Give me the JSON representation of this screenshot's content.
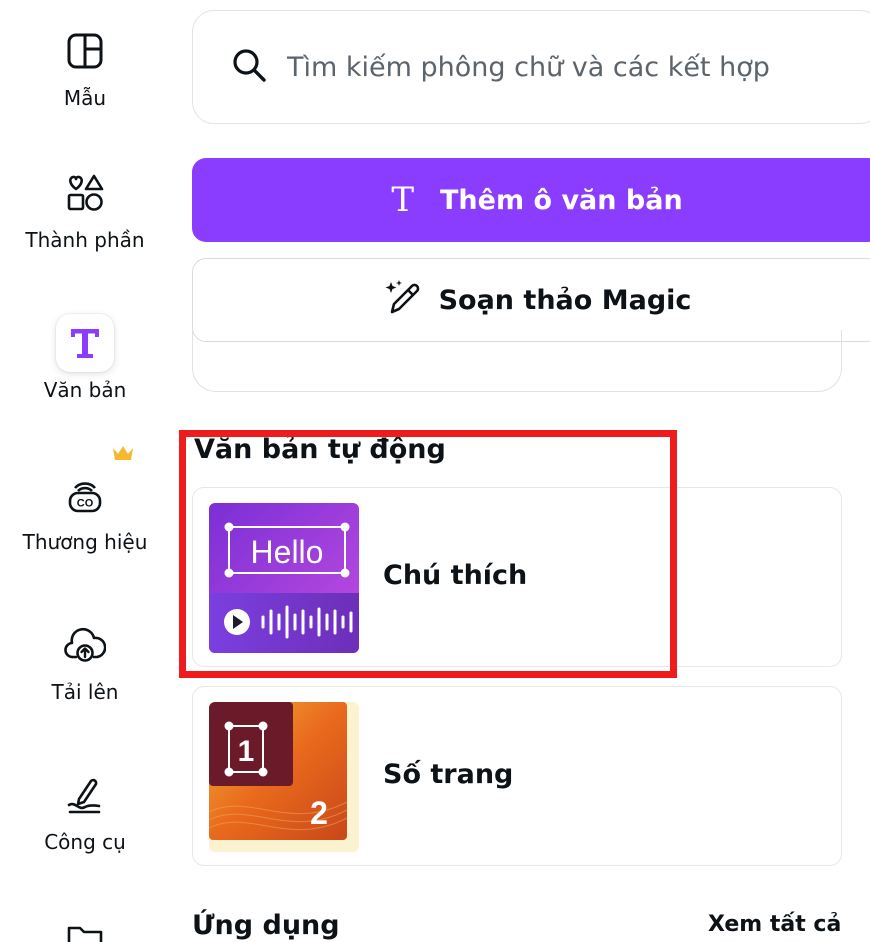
{
  "sidebar": {
    "items": [
      {
        "label": "Mẫu",
        "icon": "template-icon"
      },
      {
        "label": "Thành phần",
        "icon": "elements-icon"
      },
      {
        "label": "Văn bản",
        "icon": "text-icon",
        "active": true
      },
      {
        "label": "Thương hiệu",
        "icon": "brand-icon",
        "badge": "crown-icon"
      },
      {
        "label": "Tải lên",
        "icon": "upload-cloud-icon"
      },
      {
        "label": "Công cụ",
        "icon": "draw-pen-icon"
      },
      {
        "label": "",
        "icon": "folder-icon"
      }
    ]
  },
  "search": {
    "placeholder": "Tìm kiếm phông chữ và các kết hợp",
    "value": ""
  },
  "actions": {
    "add_textbox": "Thêm ô văn bản",
    "magic_write": "Soạn thảo Magic"
  },
  "auto_text": {
    "title": "Văn bản tự động",
    "items": [
      {
        "label": "Chú thích",
        "thumb_text": "Hello"
      },
      {
        "label": "Số trang",
        "thumb_text_1": "1",
        "thumb_text_2": "2"
      }
    ]
  },
  "apps": {
    "title": "Ứng dụng",
    "see_all": "Xem tất cả"
  },
  "colors": {
    "accent": "#8b3dff",
    "highlight": "#ee1c1c",
    "crown": "#f5b82e"
  }
}
